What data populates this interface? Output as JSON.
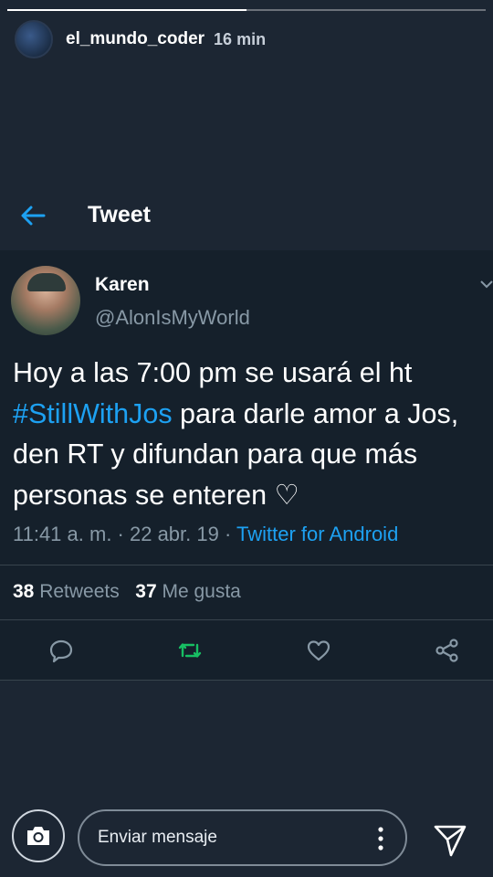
{
  "story": {
    "username": "el_mundo_coder",
    "time": "16 min",
    "progress": 0.5
  },
  "nav": {
    "title": "Tweet"
  },
  "tweet": {
    "name": "Karen",
    "handle": "@AlonIsMyWorld",
    "text_before": "Hoy a las 7:00 pm se usará el ht ",
    "hashtag": "#StillWithJos",
    "text_after": " para darle amor a Jos, den RT y difundan para que más personas se enteren ♡",
    "timestamp": "11:41 a. m. · 22 abr. 19 · ",
    "source": "Twitter for Android",
    "retweets_count": "38",
    "retweets_label": "Retweets",
    "likes_count": "37",
    "likes_label": "Me gusta"
  },
  "colors": {
    "accent": "#1da1f2",
    "retweet": "#17bf63",
    "muted": "#8899a6"
  },
  "bottom_bar": {
    "message_placeholder": "Enviar mensaje"
  }
}
